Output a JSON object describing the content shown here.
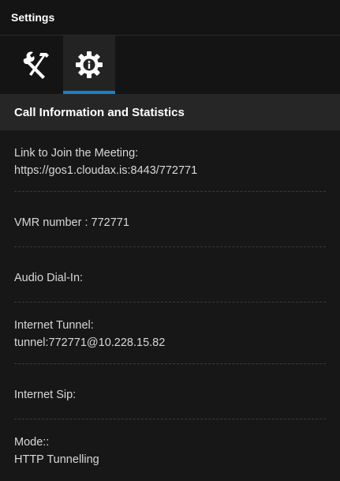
{
  "window": {
    "title": "Settings"
  },
  "tabs": [
    {
      "icon": "tools-icon",
      "label": ""
    },
    {
      "icon": "info-gear-icon",
      "label": ""
    }
  ],
  "section": {
    "title": "Call Information and Statistics"
  },
  "items": {
    "link_label": "Link to Join the Meeting:",
    "link_value": "https://gos1.cloudax.is:8443/772771",
    "vmr_text": "VMR number : 772771",
    "audio_label": "Audio Dial-In:",
    "tunnel_label": "Internet Tunnel:",
    "tunnel_value": "tunnel:772771@10.228.15.82",
    "sip_label": "Internet Sip:",
    "mode_label": "Mode::",
    "mode_value": "HTTP Tunnelling"
  },
  "colors": {
    "accent": "#1e7fc6",
    "background": "#171717",
    "header": "#262626"
  }
}
